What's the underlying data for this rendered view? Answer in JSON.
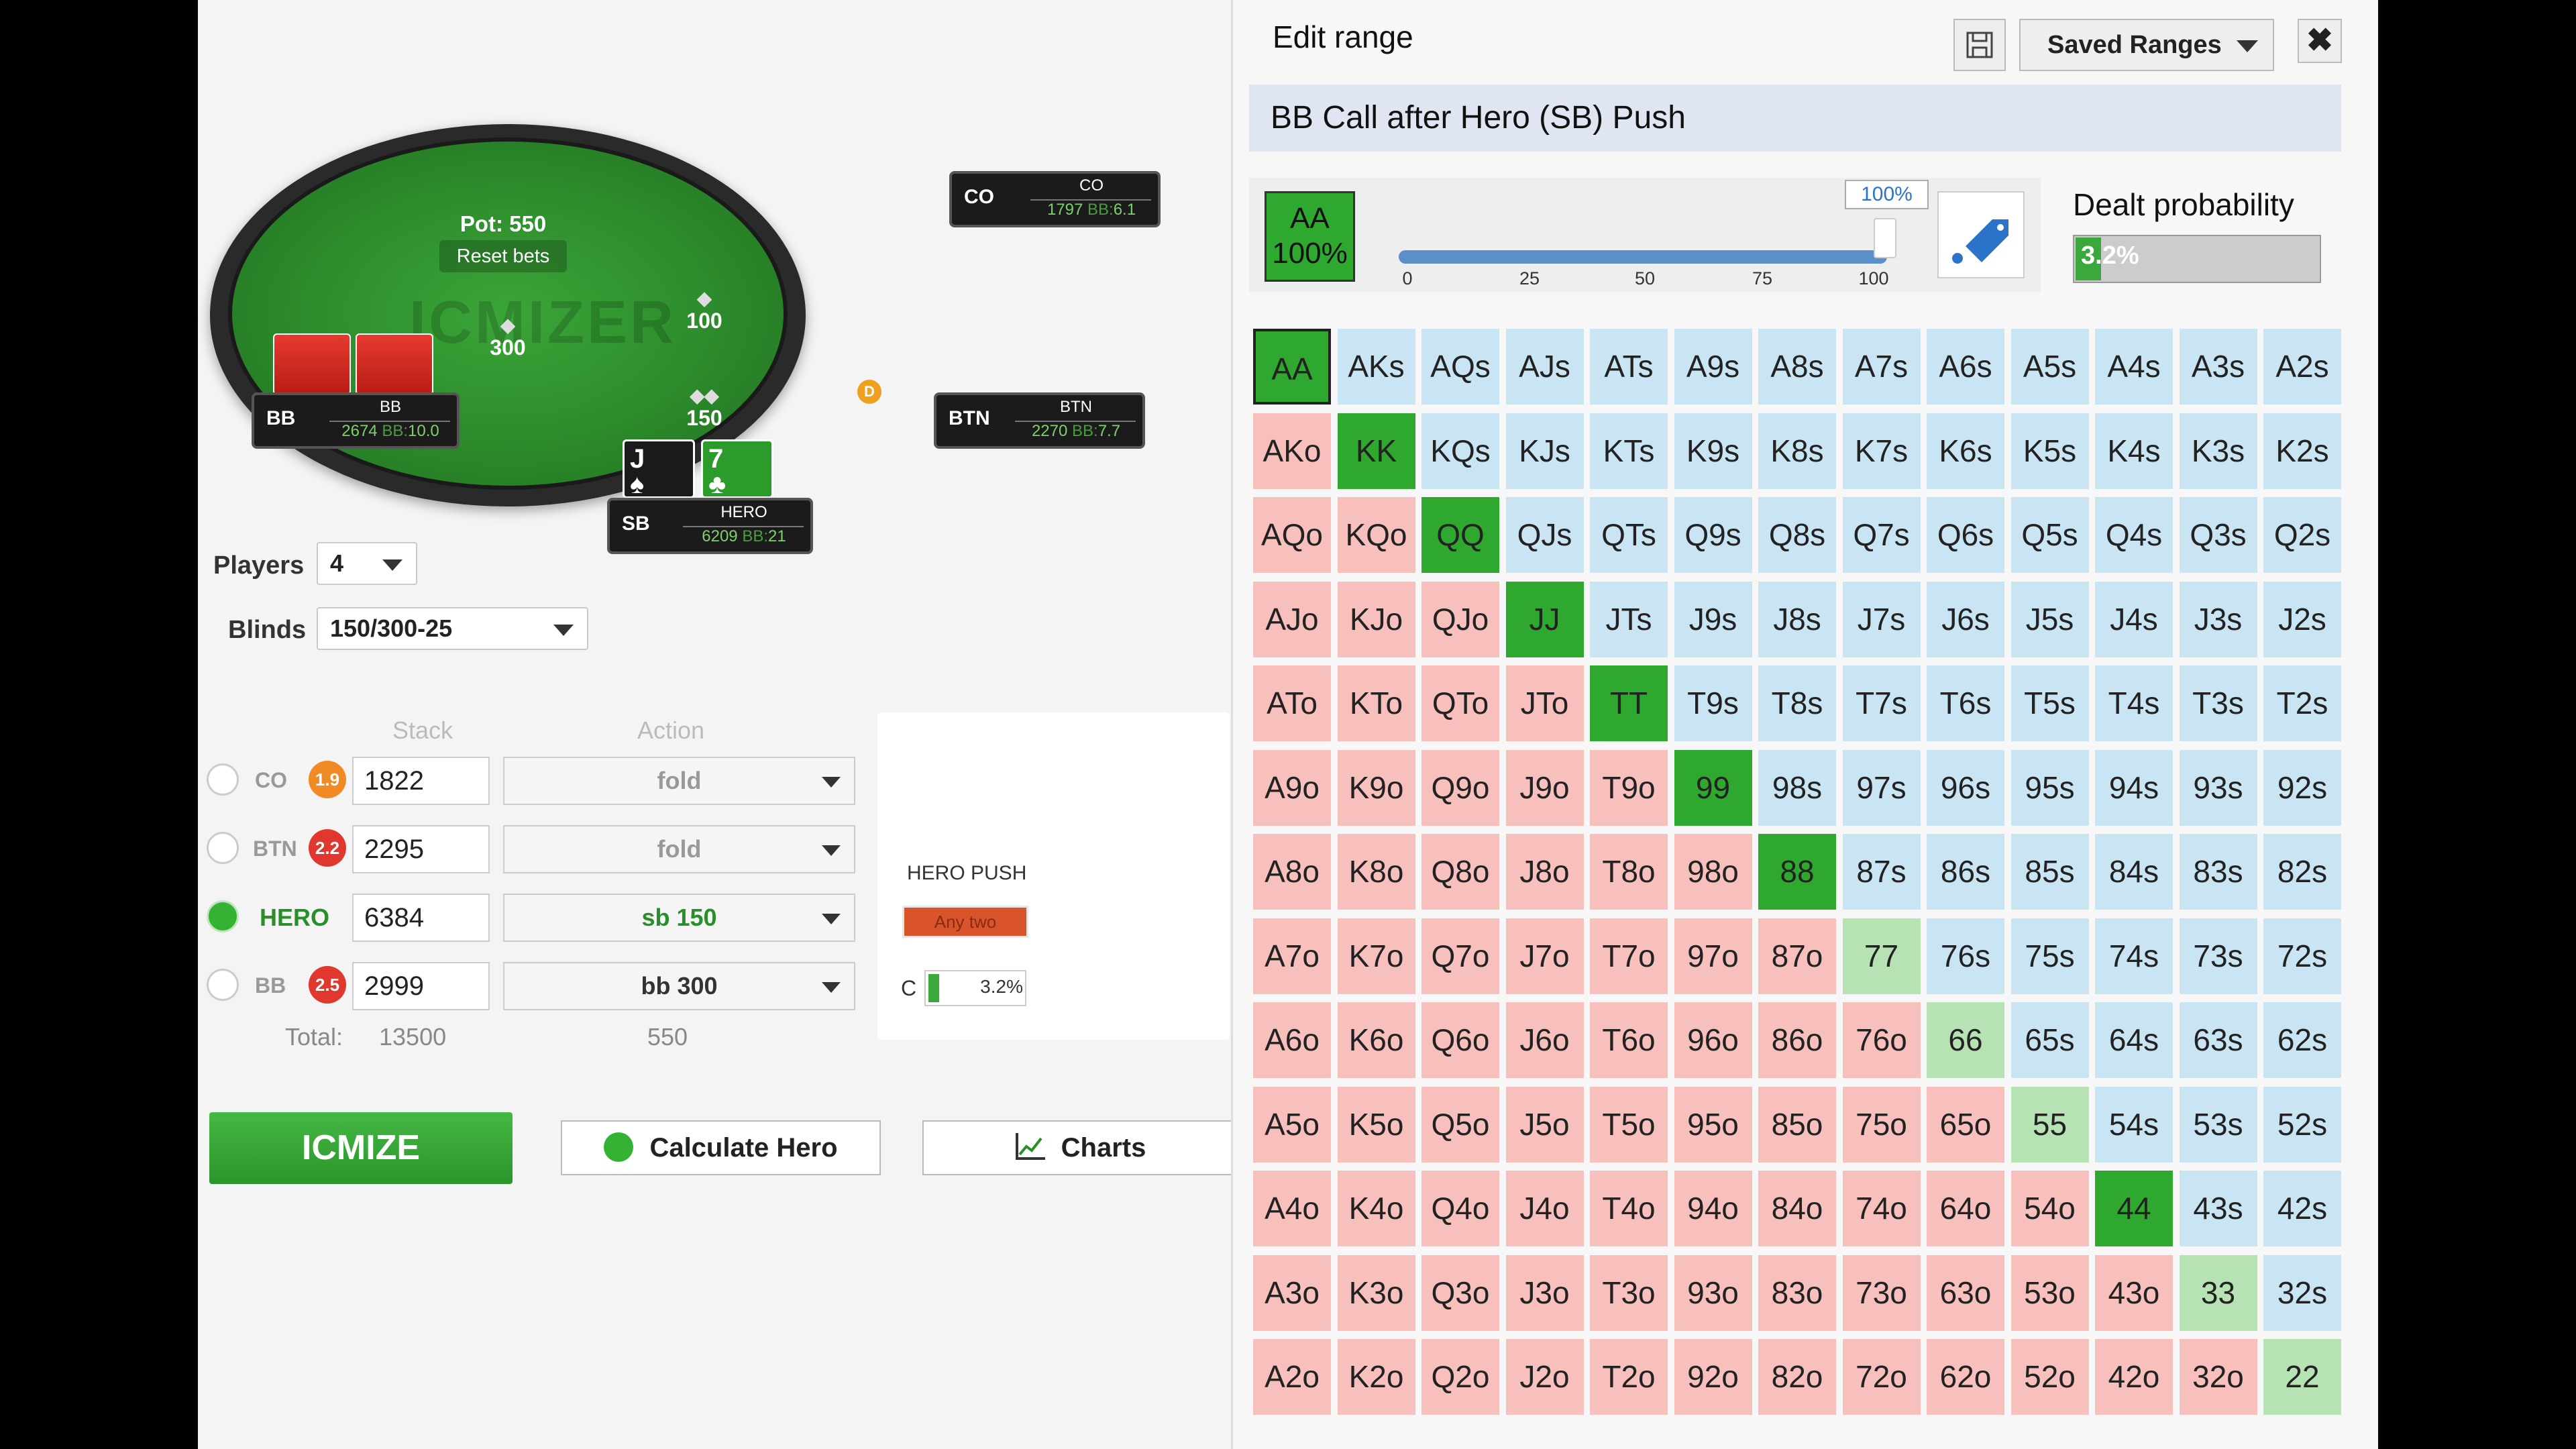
{
  "table": {
    "pot": "Pot: 550",
    "reset_label": "Reset bets",
    "watermark": "ICMIZER",
    "dealer": "D",
    "bets": {
      "bb": "300",
      "co": "100",
      "sb": "150"
    },
    "seats": {
      "co": {
        "pos": "CO",
        "name": "CO",
        "stack": "1797",
        "bb": "6.1"
      },
      "bb": {
        "pos": "BB",
        "name": "BB",
        "stack": "2674",
        "bb": "10.0"
      },
      "btn": {
        "pos": "BTN",
        "name": "BTN",
        "stack": "2270",
        "bb": "7.7"
      },
      "sb": {
        "pos": "SB",
        "name": "HERO",
        "stack": "6209",
        "bb": "21"
      }
    },
    "stack_unit": "BB:",
    "hero_cards": [
      {
        "rank": "J",
        "suit": "♠"
      },
      {
        "rank": "7",
        "suit": "♣"
      }
    ]
  },
  "controls": {
    "players_label": "Players",
    "players_value": "4",
    "blinds_label": "Blinds",
    "blinds_value": "150/300-25",
    "stack_header": "Stack",
    "action_header": "Action",
    "rows": [
      {
        "pos": "CO",
        "badge": "1.9",
        "stack": "1822",
        "action": "fold"
      },
      {
        "pos": "BTN",
        "badge": "2.2",
        "stack": "2295",
        "action": "fold"
      },
      {
        "pos": "HERO",
        "badge": "",
        "stack": "6384",
        "action": "sb 150"
      },
      {
        "pos": "BB",
        "badge": "2.5",
        "stack": "2999",
        "action": "bb 300"
      }
    ],
    "total_label": "Total:",
    "total_stack": "13500",
    "total_action": "550",
    "push_title": "HERO PUSH",
    "any_two": "Any two",
    "c_label": "C",
    "c_value": "3.2%",
    "icmize": "ICMIZE",
    "calculate_hero": "Calculate Hero",
    "charts": "Charts"
  },
  "colors": {
    "accent_green": "#34b233",
    "suited": "#c9e4f2",
    "offsuit": "#f7c0bc",
    "badge_orange": "#f08a24",
    "badge_red": "#e0382f"
  },
  "range_panel": {
    "title": "Edit range",
    "saved_ranges": "Saved Ranges",
    "close_icon": "✖",
    "range_name": "BB Call after Hero (SB) Push",
    "selected_hand": "AA",
    "selected_pct": "100%",
    "slider_pct": "100%",
    "slider_value": 100,
    "ticks": [
      "0",
      "25",
      "50",
      "75",
      "100"
    ],
    "dealt_label": "Dealt probability",
    "dealt_value": "3.2%",
    "dealt_fraction": 0.032,
    "grid_rows": [
      [
        "AA",
        "AKs",
        "AQs",
        "AJs",
        "ATs",
        "A9s",
        "A8s",
        "A7s",
        "A6s",
        "A5s",
        "A4s",
        "A3s",
        "A2s"
      ],
      [
        "AKo",
        "KK",
        "KQs",
        "KJs",
        "KTs",
        "K9s",
        "K8s",
        "K7s",
        "K6s",
        "K5s",
        "K4s",
        "K3s",
        "K2s"
      ],
      [
        "AQo",
        "KQo",
        "QQ",
        "QJs",
        "QTs",
        "Q9s",
        "Q8s",
        "Q7s",
        "Q6s",
        "Q5s",
        "Q4s",
        "Q3s",
        "Q2s"
      ],
      [
        "AJo",
        "KJo",
        "QJo",
        "JJ",
        "JTs",
        "J9s",
        "J8s",
        "J7s",
        "J6s",
        "J5s",
        "J4s",
        "J3s",
        "J2s"
      ],
      [
        "ATo",
        "KTo",
        "QTo",
        "JTo",
        "TT",
        "T9s",
        "T8s",
        "T7s",
        "T6s",
        "T5s",
        "T4s",
        "T3s",
        "T2s"
      ],
      [
        "A9o",
        "K9o",
        "Q9o",
        "J9o",
        "T9o",
        "99",
        "98s",
        "97s",
        "96s",
        "95s",
        "94s",
        "93s",
        "92s"
      ],
      [
        "A8o",
        "K8o",
        "Q8o",
        "J8o",
        "T8o",
        "98o",
        "88",
        "87s",
        "86s",
        "85s",
        "84s",
        "83s",
        "82s"
      ],
      [
        "A7o",
        "K7o",
        "Q7o",
        "J7o",
        "T7o",
        "97o",
        "87o",
        "77",
        "76s",
        "75s",
        "74s",
        "73s",
        "72s"
      ],
      [
        "A6o",
        "K6o",
        "Q6o",
        "J6o",
        "T6o",
        "96o",
        "86o",
        "76o",
        "66",
        "65s",
        "64s",
        "63s",
        "62s"
      ],
      [
        "A5o",
        "K5o",
        "Q5o",
        "J5o",
        "T5o",
        "95o",
        "85o",
        "75o",
        "65o",
        "55",
        "54s",
        "53s",
        "52s"
      ],
      [
        "A4o",
        "K4o",
        "Q4o",
        "J4o",
        "T4o",
        "94o",
        "84o",
        "74o",
        "64o",
        "54o",
        "44",
        "43s",
        "42s"
      ],
      [
        "A3o",
        "K3o",
        "Q3o",
        "J3o",
        "T3o",
        "93o",
        "83o",
        "73o",
        "63o",
        "53o",
        "43o",
        "33",
        "32s"
      ],
      [
        "A2o",
        "K2o",
        "Q2o",
        "J2o",
        "T2o",
        "92o",
        "82o",
        "72o",
        "62o",
        "52o",
        "42o",
        "32o",
        "22"
      ]
    ],
    "full_hands": [
      "AA",
      "KK",
      "QQ",
      "JJ",
      "TT",
      "99",
      "88",
      "44"
    ]
  }
}
